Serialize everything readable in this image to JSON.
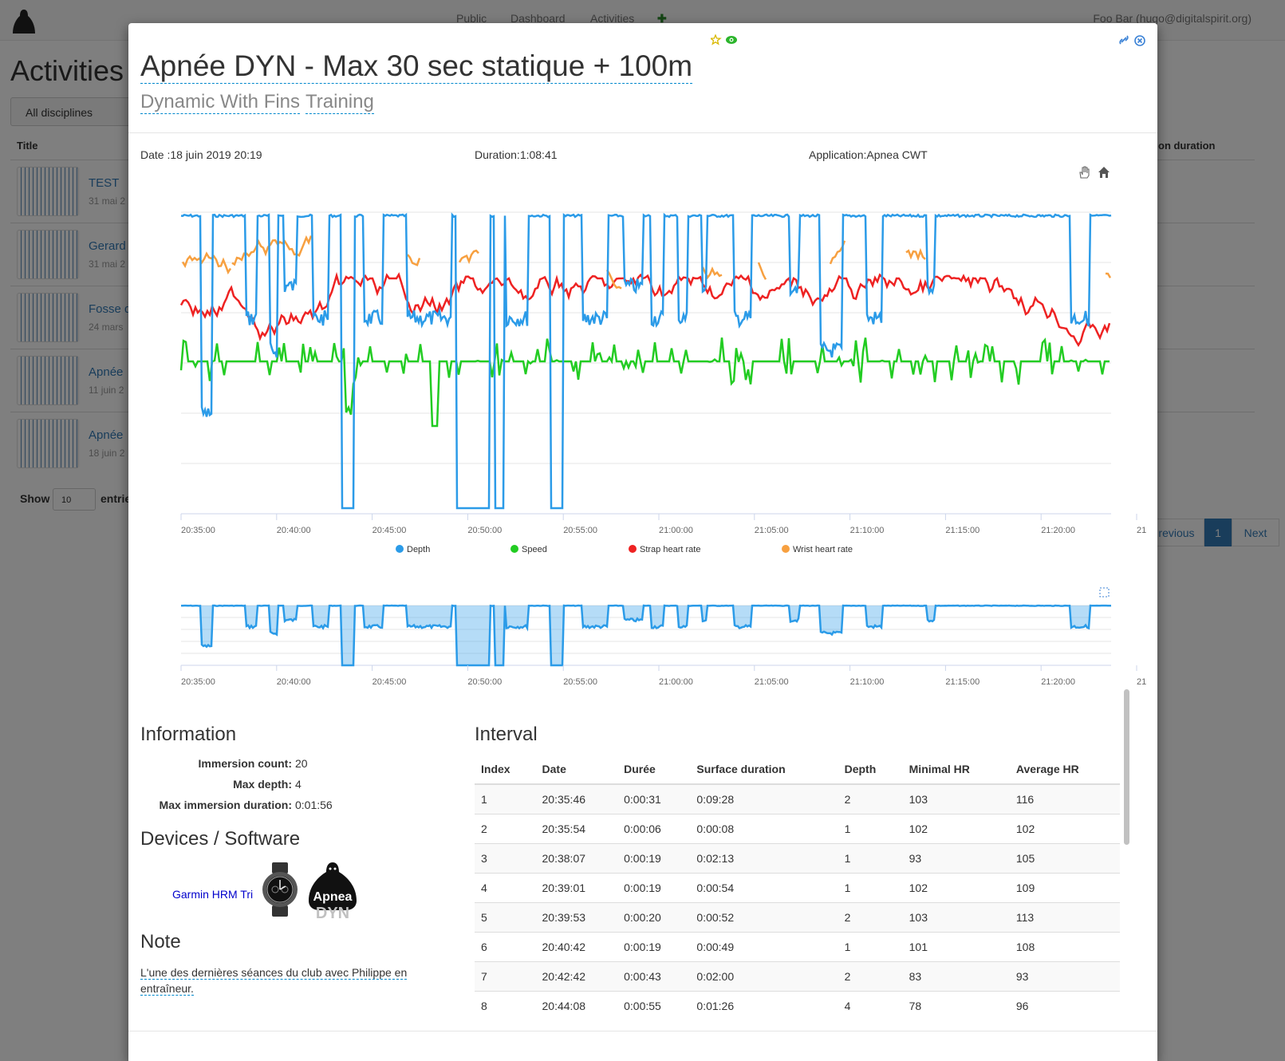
{
  "background": {
    "brand": "Apnea",
    "nav": [
      "Public",
      "Dashboard",
      "Activities"
    ],
    "add_symbol": "✚",
    "user": "Foo Bar (hugo@digitalspirit.org)",
    "page_title": "Activities",
    "filter": "All disciplines",
    "col_title": "Title",
    "col_duration": "on duration",
    "rows": [
      {
        "title": "TEST",
        "date": "31 mai 2"
      },
      {
        "title": "Gerard",
        "date": "31 mai 2"
      },
      {
        "title": "Fosse d",
        "date": "24 mars"
      },
      {
        "title": "Apnée",
        "date": "11 juin 2"
      },
      {
        "title": "Apnée",
        "date": "18 juin 2"
      }
    ],
    "show_label": "Show",
    "show_value": "10",
    "entries_label": "entrie",
    "pagination": {
      "previous": "revious",
      "current": "1",
      "next": "Next"
    }
  },
  "modal": {
    "title": "Apnée DYN - Max 30 sec statique + 100m",
    "discipline": "Dynamic With Fins",
    "category": "Training",
    "date_label": "Date :",
    "date_value": "18 juin 2019 20:19",
    "duration_label": "Duration:",
    "duration_value": "1:08:41",
    "application_label": "Application:",
    "application_value": "Apnea CWT"
  },
  "chart_data": {
    "type": "line",
    "x_ticks": [
      "20:35:00",
      "20:40:00",
      "20:45:00",
      "20:50:00",
      "20:55:00",
      "21:00:00",
      "21:05:00",
      "21:10:00",
      "21:15:00",
      "21:20:00",
      "21"
    ],
    "legend_position": "bottom",
    "series": [
      {
        "name": "Depth",
        "color": "#2b9be8"
      },
      {
        "name": "Speed",
        "color": "#22cc22"
      },
      {
        "name": "Strap heart rate",
        "color": "#ee2222"
      },
      {
        "name": "Wrist heart rate",
        "color": "#f7a040"
      }
    ],
    "navigator_ticks": [
      "20:35:00",
      "20:40:00",
      "20:45:00",
      "20:50:00",
      "20:55:00",
      "21:00:00",
      "21:05:00",
      "21:10:00",
      "21:15:00",
      "21:20:00",
      "21"
    ]
  },
  "information": {
    "heading": "Information",
    "rows": [
      {
        "label": "Immersion count:",
        "value": "20"
      },
      {
        "label": "Max depth:",
        "value": "4"
      },
      {
        "label": "Max immersion duration:",
        "value": "0:01:56"
      }
    ]
  },
  "devices": {
    "heading": "Devices / Software",
    "device_link": "Garmin HRM Tri",
    "app_logo_text": "Apnea",
    "app_logo_sub": "DYN"
  },
  "note": {
    "heading": "Note",
    "text": "L'une des dernières séances du club avec Philippe en entraîneur."
  },
  "interval": {
    "heading": "Interval",
    "columns": [
      "Index",
      "Date",
      "Durée",
      "Surface duration",
      "Depth",
      "Minimal HR",
      "Average HR"
    ],
    "rows": [
      [
        "1",
        "20:35:46",
        "0:00:31",
        "0:09:28",
        "2",
        "103",
        "116"
      ],
      [
        "2",
        "20:35:54",
        "0:00:06",
        "0:00:08",
        "1",
        "102",
        "102"
      ],
      [
        "3",
        "20:38:07",
        "0:00:19",
        "0:02:13",
        "1",
        "93",
        "105"
      ],
      [
        "4",
        "20:39:01",
        "0:00:19",
        "0:00:54",
        "1",
        "102",
        "109"
      ],
      [
        "5",
        "20:39:53",
        "0:00:20",
        "0:00:52",
        "2",
        "103",
        "113"
      ],
      [
        "6",
        "20:40:42",
        "0:00:19",
        "0:00:49",
        "1",
        "101",
        "108"
      ],
      [
        "7",
        "20:42:42",
        "0:00:43",
        "0:02:00",
        "2",
        "83",
        "93"
      ],
      [
        "8",
        "20:44:08",
        "0:00:55",
        "0:01:26",
        "4",
        "78",
        "96"
      ]
    ]
  }
}
